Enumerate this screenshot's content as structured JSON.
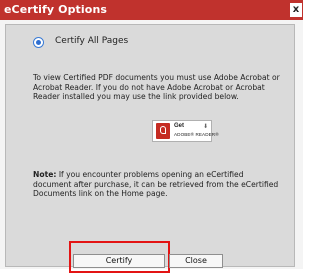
{
  "window": {
    "title": "eCertify Options",
    "close_glyph": "x"
  },
  "options": {
    "radio_label": "Certify All Pages",
    "selected": true
  },
  "content": {
    "para1": "To view Certified PDF documents you must use Adobe Acrobat or Acrobat Reader. If you do not have Adobe Acrobat or Acrobat Reader installed you may use the link provided below.",
    "reader_badge": {
      "get_text": "Get",
      "reader_text": "ADOBE® READER®",
      "icon": "adobe-reader-icon",
      "arrow": "⬇"
    },
    "note_label": "Note:",
    "note_text": "If you encounter problems opening an eCertified document after purchase, it can be retrieved from the eCertified Documents link on the Home page."
  },
  "buttons": {
    "certify": "Certify",
    "close": "Close"
  },
  "colors": {
    "titlebar": "#c0322d",
    "highlight": "#e31414",
    "radio": "#2f6fd1"
  }
}
